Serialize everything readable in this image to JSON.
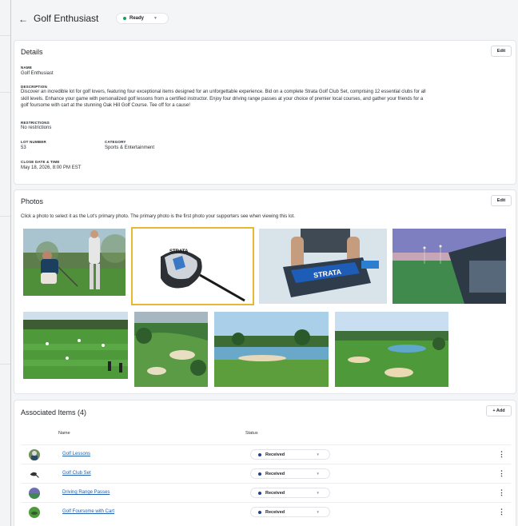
{
  "header": {
    "back_icon": "arrow-left-icon",
    "title": "Golf Enthusiast",
    "status": "Ready",
    "status_color": "#1e9e54"
  },
  "details": {
    "title": "Details",
    "edit_label": "Edit",
    "name_label": "NAME",
    "name_value": "Golf Enthusiast",
    "description_label": "DESCRIPTION",
    "description_line1": "Discover an incredible lot for golf lovers, featuring four exceptional items designed for an unforgettable experience. Bid on a complete Strata Golf Club Set, comprising 12 essential clubs for all",
    "description_line2": "skill levels. Enhance your game with personalized golf lessons from a certified instructor. Enjoy four driving range passes at your choice of premier local courses, and gather your friends for a",
    "description_line3": "golf foursome with cart at the stunning Oak Hill Golf Course. Tee off for a cause!",
    "restrictions_label": "RESTRICTIONS",
    "restrictions_value": "No restrictions",
    "lot_number_label": "LOT NUMBER",
    "lot_number_value": "53",
    "category_label": "CATEGORY",
    "category_value": "Sports & Entertainment",
    "close_label": "CLOSE DATE & TIME",
    "close_value": "May 18, 2026, 8:00 PM EST"
  },
  "photos": {
    "title": "Photos",
    "edit_label": "Edit",
    "instructions": "Click a photo to select it as the Lot's primary photo. The primary photo is the first photo your supporters see when viewing this lot.",
    "driver_brand": "STRATA",
    "bag_brand": "STRATA",
    "selected_color": "#e8b930"
  },
  "items": {
    "title": "Associated Items (4)",
    "add_label": "+ Add",
    "col_name": "Name",
    "col_status": "Status",
    "status_color": "#1d3f8f",
    "rows": [
      {
        "name": "Golf Lessons",
        "status": "Received"
      },
      {
        "name": "Golf Club Set",
        "status": "Received"
      },
      {
        "name": "Driving Range Passes",
        "status": "Received"
      },
      {
        "name": "Golf Foursome with Cart",
        "status": "Received"
      }
    ]
  }
}
